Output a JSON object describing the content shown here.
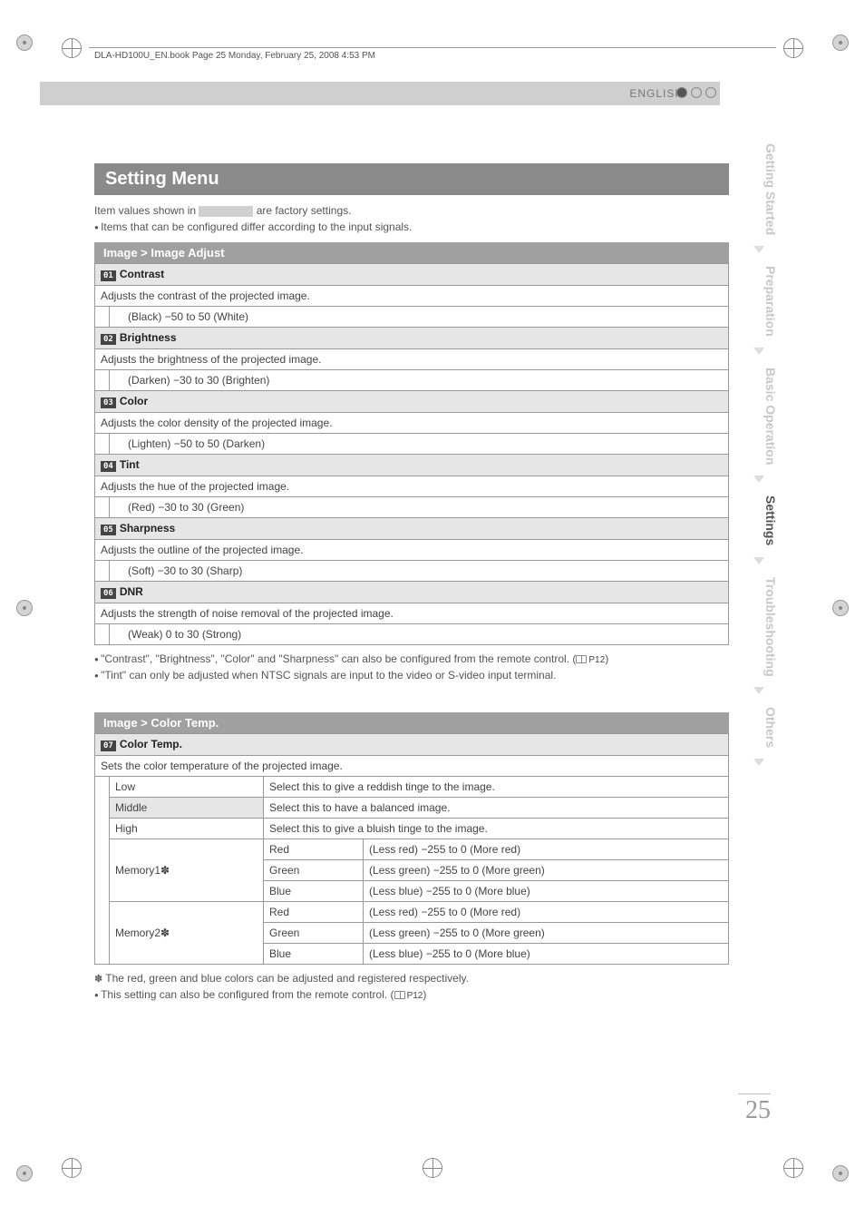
{
  "pageinfo": "DLA-HD100U_EN.book  Page 25  Monday, February 25, 2008  4:53 PM",
  "language": "ENGLISH",
  "side_tabs": {
    "t0": "Getting Started",
    "t1": "Preparation",
    "t2": "Basic Operation",
    "t3": "Settings",
    "t4": "Troubleshooting",
    "t5": "Others"
  },
  "title": "Setting Menu",
  "intro_before": "Item values shown in ",
  "intro_after": " are factory settings.",
  "intro_bullet": "Items that can be configured differ according to the input signals.",
  "sectionA": "Image > Image Adjust",
  "items": {
    "i1": {
      "num": "01",
      "name": "Contrast",
      "desc": "Adjusts the contrast of the projected image.",
      "range": "(Black) −50 to 50 (White)"
    },
    "i2": {
      "num": "02",
      "name": "Brightness",
      "desc": "Adjusts the brightness of the projected image.",
      "range": "(Darken) −30 to 30 (Brighten)"
    },
    "i3": {
      "num": "03",
      "name": "Color",
      "desc": "Adjusts the color density of the projected image.",
      "range": "(Lighten) −50 to 50 (Darken)"
    },
    "i4": {
      "num": "04",
      "name": "Tint",
      "desc": "Adjusts the hue of the projected image.",
      "range": "(Red) −30 to 30 (Green)"
    },
    "i5": {
      "num": "05",
      "name": "Sharpness",
      "desc": "Adjusts the outline of the projected image.",
      "range": "(Soft) −30 to 30 (Sharp)"
    },
    "i6": {
      "num": "06",
      "name": "DNR",
      "desc": "Adjusts the strength of noise removal of the projected image.",
      "range": "(Weak) 0 to 30 (Strong)"
    }
  },
  "notesA": {
    "n1a": "\"Contrast\", \"Brightness\", \"Color\" and \"Sharpness\" can also be configured from the remote control. (",
    "n1b": "P12",
    "n1c": ")",
    "n2": "\"Tint\" can only be adjusted when NTSC signals are input to the video or S-video input terminal."
  },
  "sectionB": "Image > Color Temp.",
  "ct": {
    "num": "07",
    "name": "Color Temp.",
    "desc": "Sets the color temperature of the projected image.",
    "rows": {
      "low": {
        "k": "Low",
        "v": "Select this to give a reddish tinge to the image."
      },
      "middle": {
        "k": "Middle",
        "v": "Select this to have a balanced image."
      },
      "high": {
        "k": "High",
        "v": "Select this to give a bluish tinge to the image."
      },
      "m1": "Memory1✽",
      "m2": "Memory2✽",
      "red": "Red",
      "green": "Green",
      "blue": "Blue",
      "rr": "(Less red) −255 to 0 (More red)",
      "gr": "(Less green) −255 to 0 (More green)",
      "br": "(Less blue) −255 to 0 (More blue)"
    }
  },
  "notesB": {
    "star": "The red, green and blue colors can be adjusted and registered respectively.",
    "b1a": "This setting can also be configured from the remote control. (",
    "b1b": "P12",
    "b1c": ")"
  },
  "pagenum": "25"
}
